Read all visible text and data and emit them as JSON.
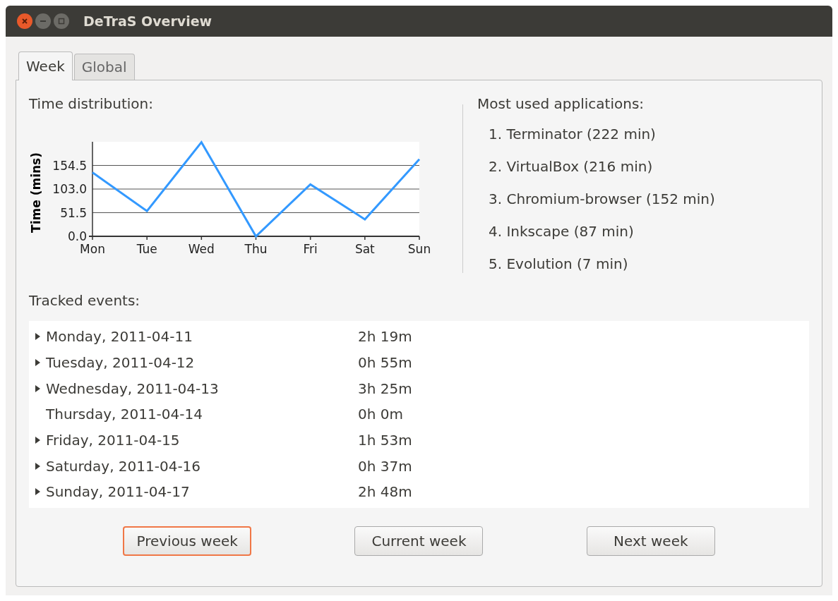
{
  "window": {
    "title": "DeTraS Overview"
  },
  "tabs": [
    {
      "label": "Week",
      "selected": true
    },
    {
      "label": "Global",
      "selected": false
    }
  ],
  "time_distribution": {
    "heading": "Time distribution:",
    "chart_data": {
      "type": "line",
      "ylabel": "Time (mins)",
      "categories": [
        "Mon",
        "Tue",
        "Wed",
        "Thu",
        "Fri",
        "Sat",
        "Sun"
      ],
      "grid": true,
      "series": [
        {
          "color": "#3399ff",
          "values": [
            139,
            55,
            205,
            0,
            113,
            37,
            168
          ]
        }
      ],
      "ylim": [
        0,
        206
      ],
      "yticks": [
        {
          "value": 0,
          "label": "0.0"
        },
        {
          "value": 51.5,
          "label": "51.5"
        },
        {
          "value": 103,
          "label": "103.0"
        },
        {
          "value": 154.5,
          "label": "154.5"
        }
      ]
    }
  },
  "most_used": {
    "heading": "Most used applications:",
    "items": [
      "1. Terminator (222 min)",
      "2. VirtualBox (216 min)",
      "3. Chromium-browser (152 min)",
      "4. Inkscape (87 min)",
      "5. Evolution (7 min)"
    ]
  },
  "tracked_events": {
    "heading": "Tracked events:",
    "rows": [
      {
        "day": "Monday, 2011-04-11",
        "time": "2h 19m",
        "expandable": true
      },
      {
        "day": "Tuesday, 2011-04-12",
        "time": "0h 55m",
        "expandable": true
      },
      {
        "day": "Wednesday, 2011-04-13",
        "time": "3h 25m",
        "expandable": true
      },
      {
        "day": "Thursday, 2011-04-14",
        "time": "0h 0m",
        "expandable": false
      },
      {
        "day": "Friday, 2011-04-15",
        "time": "1h 53m",
        "expandable": true
      },
      {
        "day": "Saturday, 2011-04-16",
        "time": "0h 37m",
        "expandable": true
      },
      {
        "day": "Sunday, 2011-04-17",
        "time": "2h 48m",
        "expandable": true
      }
    ]
  },
  "buttons": [
    {
      "label": "Previous week",
      "focused": true
    },
    {
      "label": "Current week",
      "focused": false
    },
    {
      "label": "Next week",
      "focused": false
    }
  ]
}
